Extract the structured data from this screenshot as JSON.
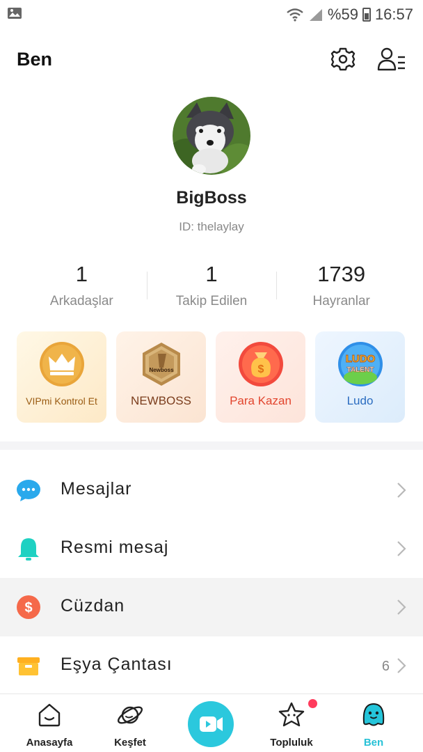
{
  "status_bar": {
    "battery": "%59",
    "time": "16:57"
  },
  "header": {
    "title": "Ben"
  },
  "profile": {
    "username": "BigBoss",
    "id_text": "ID: thelaylay"
  },
  "stats": [
    {
      "value": "1",
      "label": "Arkadaşlar"
    },
    {
      "value": "1",
      "label": "Takip Edilen"
    },
    {
      "value": "1739",
      "label": "Hayranlar"
    }
  ],
  "cards": [
    {
      "label": "VIPmi Kontrol Et",
      "icon": "crown-icon"
    },
    {
      "label": "NEWBOSS",
      "icon": "newboss-badge-icon",
      "badge_text": "Newboss"
    },
    {
      "label": "Para Kazan",
      "icon": "money-bag-icon"
    },
    {
      "label": "Ludo",
      "icon": "ludo-talent-icon",
      "badge_line1": "LUDO",
      "badge_line2": "TALENT"
    }
  ],
  "menu": [
    {
      "label": "Mesajlar",
      "icon": "chat-bubble-icon",
      "count": ""
    },
    {
      "label": "Resmi mesaj",
      "icon": "bell-icon",
      "count": ""
    },
    {
      "label": "Cüzdan",
      "icon": "wallet-dollar-icon",
      "count": ""
    },
    {
      "label": "Eşya Çantası",
      "icon": "bag-icon",
      "count": "6"
    }
  ],
  "bottom_nav": [
    {
      "label": "Anasayfa",
      "icon": "home-icon"
    },
    {
      "label": "Keşfet",
      "icon": "planet-icon"
    },
    {
      "label": "",
      "icon": "video-camera-icon"
    },
    {
      "label": "Topluluk",
      "icon": "star-face-icon"
    },
    {
      "label": "Ben",
      "icon": "profile-face-icon"
    }
  ],
  "colors": {
    "accent": "#2bc8dd",
    "notification": "#ff3b5c"
  }
}
